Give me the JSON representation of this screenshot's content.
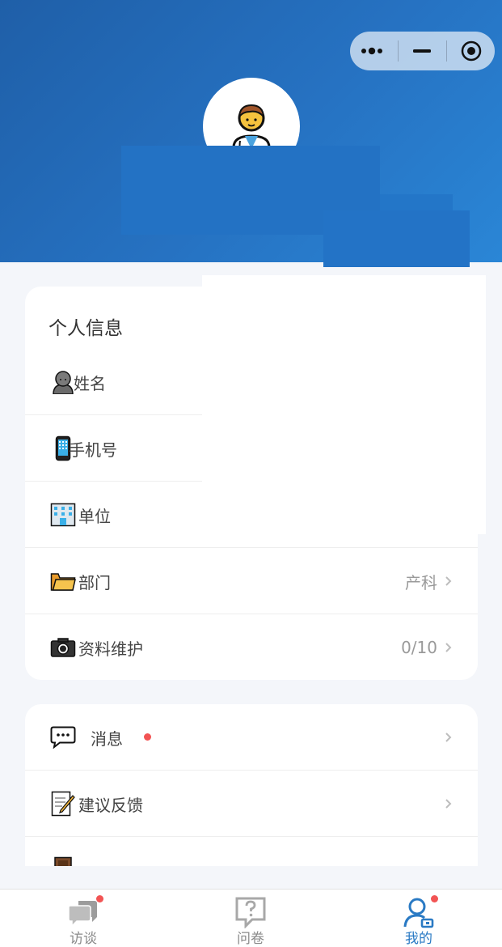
{
  "header": {
    "capsule": {
      "more_icon": "more-dots-icon",
      "minimize_icon": "minimize-icon",
      "close_icon": "target-circle-icon"
    },
    "avatar_icon": "doctor-avatar-icon",
    "colors": {
      "gradient_start": "#1f5fa8",
      "gradient_end": "#2a86d6"
    }
  },
  "profile": {
    "title": "个人信息",
    "rows": [
      {
        "icon": "person-icon",
        "label": "姓名",
        "value": ""
      },
      {
        "icon": "phone-icon",
        "label": "手机号",
        "value": ""
      },
      {
        "icon": "building-icon",
        "label": "单位",
        "value": ""
      },
      {
        "icon": "folder-icon",
        "label": "部门",
        "value": "产科"
      },
      {
        "icon": "camera-icon",
        "label": "资料维护",
        "value": "0/10"
      }
    ]
  },
  "menu": {
    "rows": [
      {
        "icon": "message-icon",
        "label": "消息",
        "has_badge": true
      },
      {
        "icon": "memo-icon",
        "label": "建议反馈",
        "has_badge": false
      }
    ]
  },
  "tabbar": {
    "tabs": [
      {
        "icon": "interview-icon",
        "label": "访谈",
        "active": false,
        "has_badge": true
      },
      {
        "icon": "questionnaire-icon",
        "label": "问卷",
        "active": false,
        "has_badge": false
      },
      {
        "icon": "profile-icon",
        "label": "我的",
        "active": true,
        "has_badge": true
      }
    ],
    "active_color": "#2a7ac4",
    "badge_color": "#f25454"
  }
}
